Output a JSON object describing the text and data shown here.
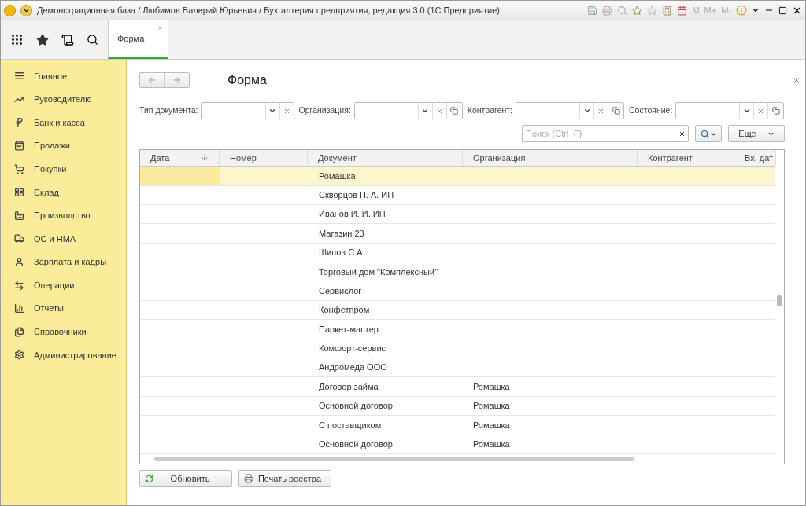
{
  "window": {
    "title": "Демонстрационная база / Любимов Валерий Юрьевич / Бухгалтерия предприятия, редакция 3.0  (1С:Предприятие)",
    "memory_buttons": [
      "M",
      "M+",
      "M-"
    ]
  },
  "tabs": [
    {
      "label": "Форма",
      "selected": true
    }
  ],
  "sidebar": {
    "items": [
      {
        "label": "Главное"
      },
      {
        "label": "Руководителю"
      },
      {
        "label": "Банк и касса"
      },
      {
        "label": "Продажи"
      },
      {
        "label": "Покупки"
      },
      {
        "label": "Склад"
      },
      {
        "label": "Производство"
      },
      {
        "label": "ОС и НМА"
      },
      {
        "label": "Зарплата и кадры"
      },
      {
        "label": "Операции"
      },
      {
        "label": "Отчеты"
      },
      {
        "label": "Справочники"
      },
      {
        "label": "Администрирование"
      }
    ]
  },
  "form": {
    "title": "Форма",
    "filters": [
      {
        "label": "Тип документа:",
        "open_button": false
      },
      {
        "label": "Организация:",
        "open_button": true
      },
      {
        "label": "Контрагент:",
        "open_button": true
      },
      {
        "label": "Состояние:",
        "open_button": true
      }
    ],
    "search": {
      "placeholder": "Поиск (Ctrl+F)"
    },
    "more_button": "Еще",
    "table": {
      "columns": [
        {
          "label": "Дата",
          "sorted": true
        },
        {
          "label": "Номер",
          "sorted": false
        },
        {
          "label": "Документ",
          "sorted": false
        },
        {
          "label": "Организация",
          "sorted": false
        },
        {
          "label": "Контрагент",
          "sorted": false
        },
        {
          "label": "Вх. дат",
          "sorted": false
        }
      ],
      "rows": [
        {
          "document": "Ромашка",
          "selected": true
        },
        {
          "document": "Скворцов П. А. ИП",
          "selected": false
        },
        {
          "document": "Иванов И. И. ИП",
          "selected": false
        },
        {
          "document": "Магазин 23",
          "selected": false
        },
        {
          "document": "Шипов С.А.",
          "selected": false
        },
        {
          "document": "Торговый дом \"Комплексный\"",
          "selected": false
        },
        {
          "document": "Сервислог",
          "selected": false
        },
        {
          "document": "Конфетпром",
          "selected": false
        },
        {
          "document": "Паркет-мастер",
          "selected": false
        },
        {
          "document": "Комфорт-сервис",
          "selected": false
        },
        {
          "document": "Андромеда ООО",
          "selected": false
        },
        {
          "document": "Договор займа",
          "organization": "Ромашка",
          "selected": false
        },
        {
          "document": "Основной договор",
          "organization": "Ромашка",
          "selected": false
        },
        {
          "document": "С поставщиком",
          "organization": "Ромашка",
          "selected": false
        },
        {
          "document": "Основной договор",
          "organization": "Ромашка",
          "selected": false
        }
      ]
    },
    "buttons": [
      {
        "label": "Обновить",
        "kind": "refresh"
      },
      {
        "label": "Печать реестра",
        "kind": "print"
      }
    ]
  }
}
